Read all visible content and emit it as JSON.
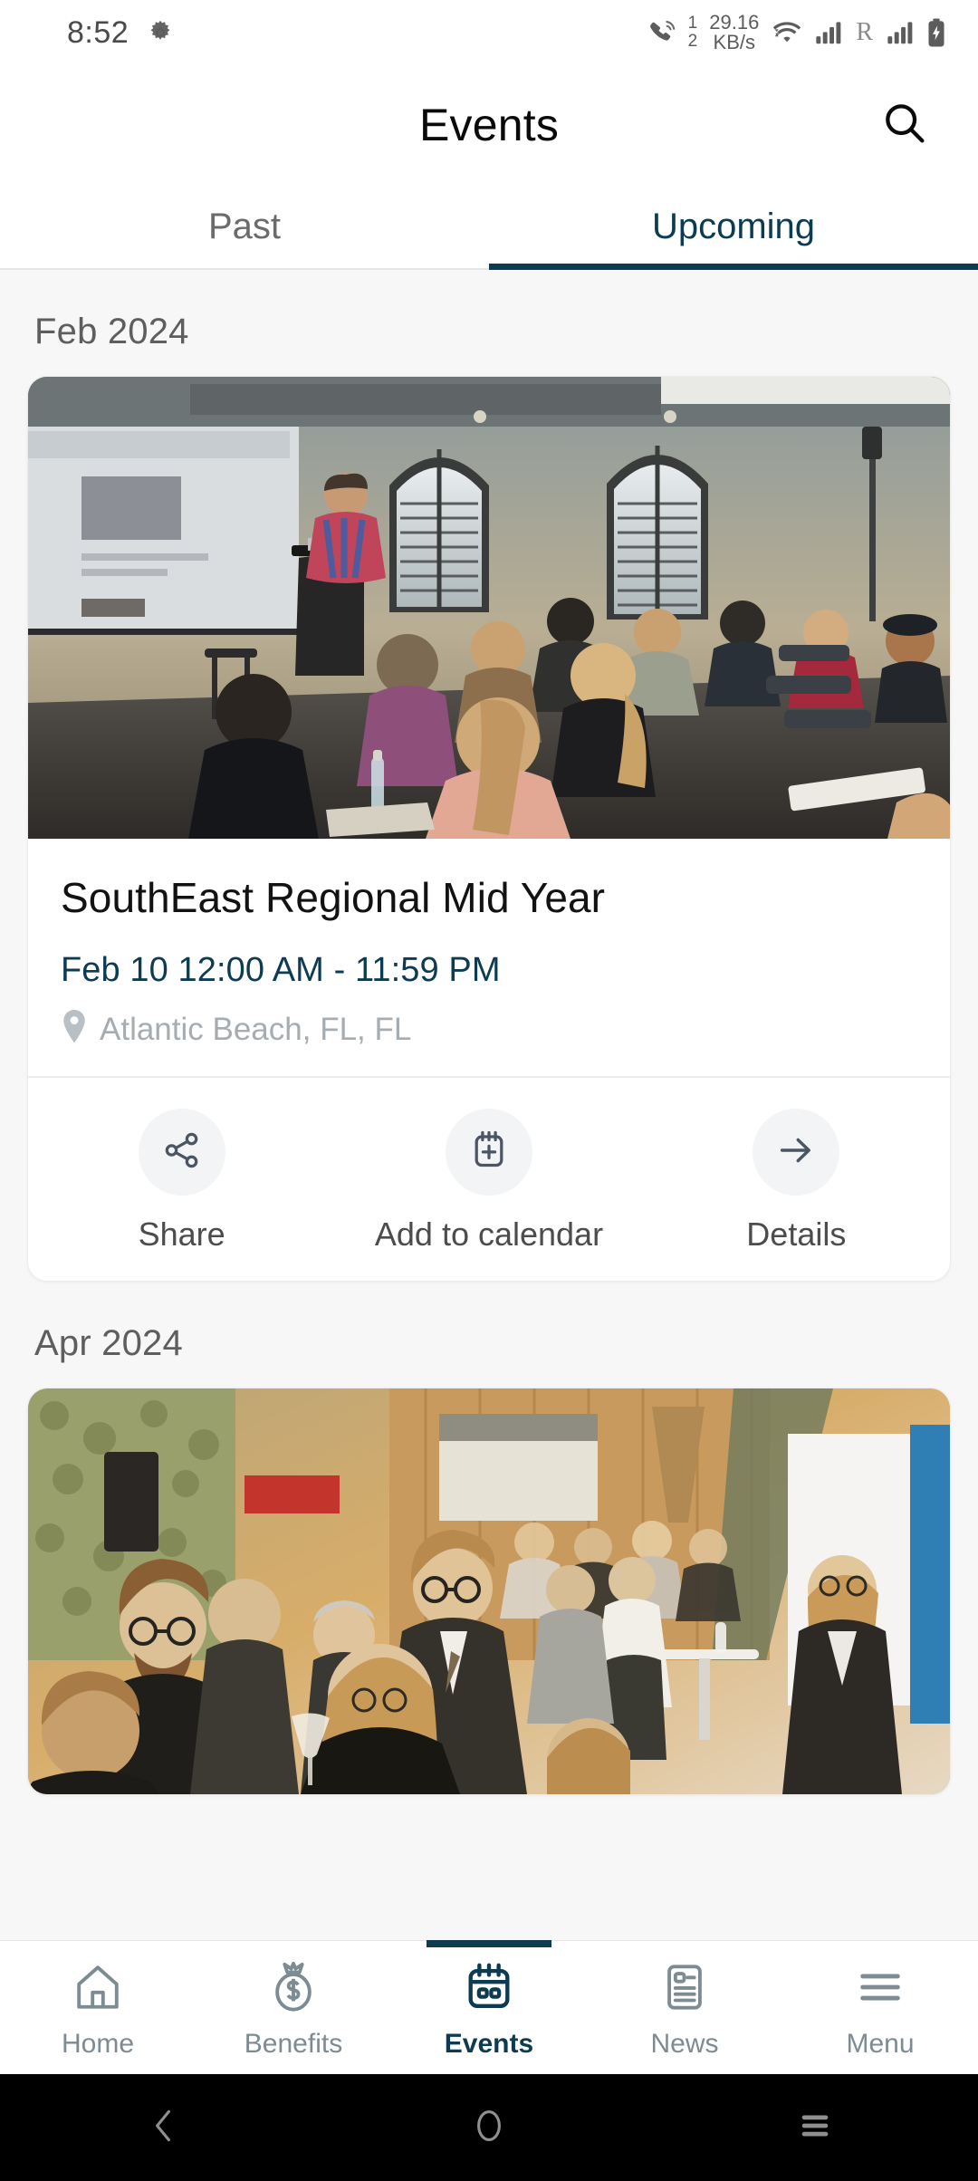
{
  "statusbar": {
    "time": "8:52",
    "gear_icon": "settings-gear-icon",
    "call_icon": "phone-call-icon",
    "sim_top": "1",
    "sim_bottom": "2",
    "netspeed_value": "29.16",
    "netspeed_unit": "KB/s",
    "wifi_icon": "wifi-icon",
    "signal1_icon": "cellular-signal-icon",
    "roaming": "R",
    "signal2_icon": "cellular-signal-icon",
    "battery_icon": "battery-charging-icon"
  },
  "header": {
    "title": "Events",
    "search_icon": "search-icon"
  },
  "tabs": [
    {
      "label": "Past",
      "active": false
    },
    {
      "label": "Upcoming",
      "active": true
    }
  ],
  "sections": [
    {
      "month": "Feb 2024",
      "event": {
        "title": "SouthEast Regional Mid Year",
        "date": "Feb 10",
        "time": "12:00 AM - 11:59 PM",
        "when": "Feb 10   12:00 AM - 11:59 PM",
        "location_icon": "map-pin-icon",
        "location": "Atlantic Beach, FL, FL",
        "photo_alt": "seminar-room-audience-photo",
        "actions": [
          {
            "label": "Share",
            "icon": "share-icon"
          },
          {
            "label": "Add to calendar",
            "icon": "calendar-plus-icon"
          },
          {
            "label": "Details",
            "icon": "arrow-right-icon"
          }
        ]
      }
    },
    {
      "month": "Apr 2024",
      "event": {
        "photo_alt": "networking-reception-photo"
      }
    }
  ],
  "bottomnav": [
    {
      "label": "Home",
      "icon": "home-icon",
      "active": false
    },
    {
      "label": "Benefits",
      "icon": "money-bag-icon",
      "active": false
    },
    {
      "label": "Events",
      "icon": "calendar-icon",
      "active": true
    },
    {
      "label": "News",
      "icon": "newspaper-icon",
      "active": false
    },
    {
      "label": "Menu",
      "icon": "hamburger-menu-icon",
      "active": false
    }
  ],
  "sysnav": [
    {
      "name": "back-button",
      "icon": "chevron-left-icon"
    },
    {
      "name": "home-button",
      "icon": "circle-icon"
    },
    {
      "name": "recents-button",
      "icon": "hamburger-icon"
    }
  ],
  "colors": {
    "accent": "#0d3b52",
    "page_bg": "#f7f7f7",
    "card_bg": "#ffffff",
    "muted_text": "#a6adb2"
  }
}
